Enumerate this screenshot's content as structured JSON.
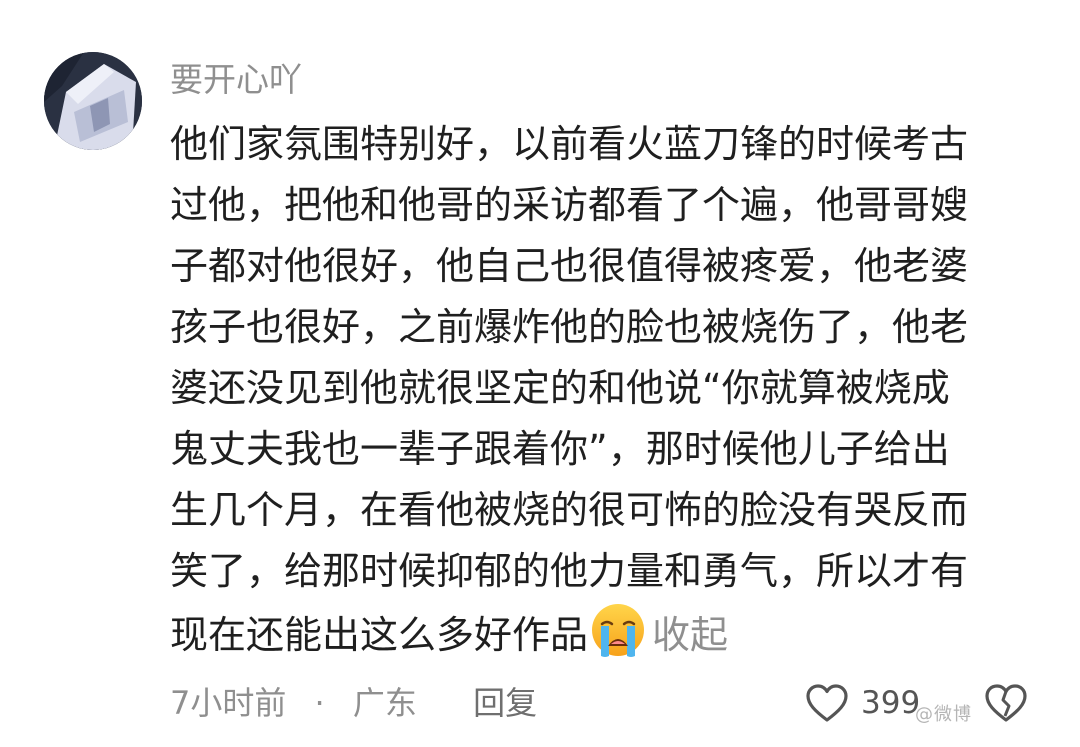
{
  "comment": {
    "username": "要开心吖",
    "lines": [
      "他们家氛围特别好，以前看火蓝刀锋的时候考古",
      "过他，把他和他哥的采访都看了个遍，他哥哥嫂",
      "子都对他很好，他自己也很值得被疼爱，他老婆",
      "孩子也很好，之前爆炸他的脸也被烧伤了，他老",
      "婆还没见到他就很坚定的和他说“你就算被烧成",
      "鬼丈夫我也一辈子跟着你”，那时候他儿子给出",
      "生几个月，在看他被烧的很可怖的脸没有哭反而",
      "笑了，给那时候抑郁的他力量和勇气，所以才有",
      "现在还能出这么多好作品"
    ],
    "emoji": "loudly-crying-face-icon",
    "collapse_label": "收起",
    "time": "7小时前",
    "separator": "·",
    "location": "广东",
    "reply_label": "回复",
    "like_count": "399",
    "watermark": "@微博"
  },
  "colors": {
    "text": "#1f1f1f",
    "meta": "#8f8f8f",
    "background": "#ffffff"
  }
}
